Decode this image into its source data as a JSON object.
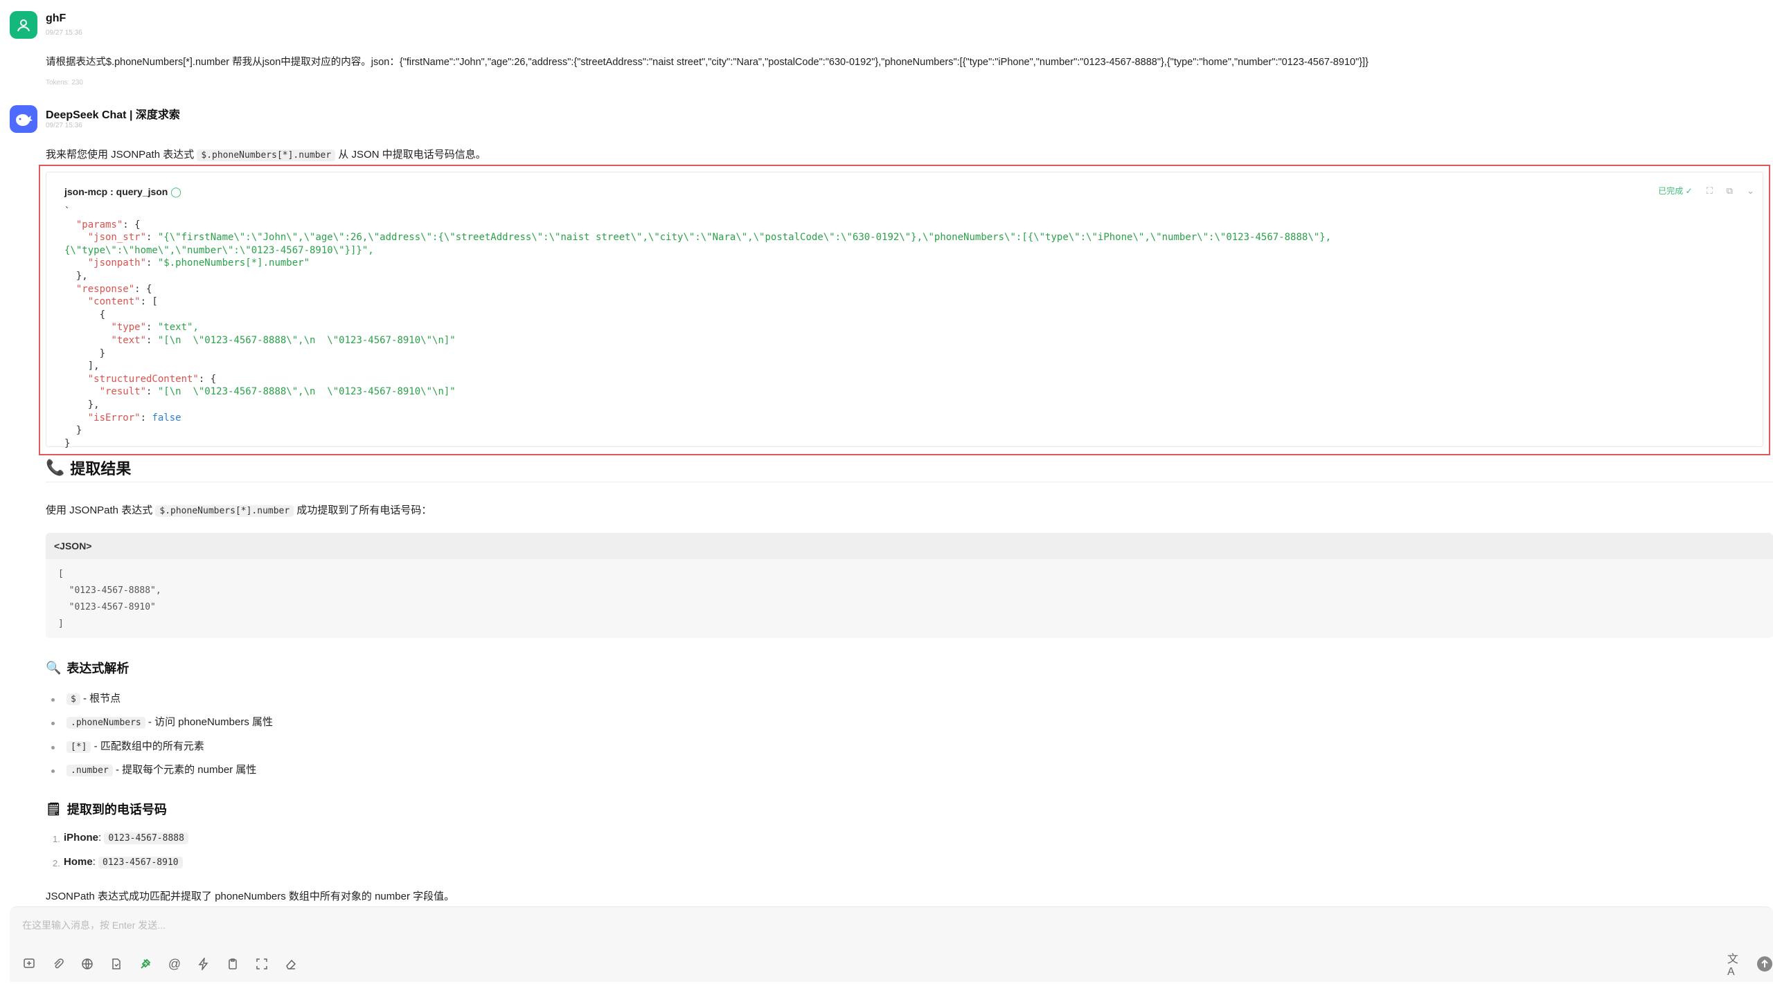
{
  "user_message": {
    "name": "ghF",
    "time": "09/27 15:36",
    "text": "请根据表达式$.phoneNumbers[*].number 帮我从json中提取对应的内容。json：{\"firstName\":\"John\",\"age\":26,\"address\":{\"streetAddress\":\"naist street\",\"city\":\"Nara\",\"postalCode\":\"630-0192\"},\"phoneNumbers\":[{\"type\":\"iPhone\",\"number\":\"0123-4567-8888\"},{\"type\":\"home\",\"number\":\"0123-4567-8910\"}]}",
    "tokens": "Tokens: 230"
  },
  "bot_message": {
    "name": "DeepSeek Chat | 深度求索",
    "time": "09/27 15:36",
    "intro_before": "我来帮您使用 JSONPath 表达式",
    "intro_code": "$.phoneNumbers[*].number",
    "intro_after": "从 JSON 中提取电话号码信息。"
  },
  "tool_call": {
    "title": "json-mcp : query_json",
    "status": "已完成",
    "params_key": "\"params\"",
    "json_str_key": "\"json_str\"",
    "json_str_value_1": "\"{\\\"firstName\\\":\\\"John\\\",\\\"age\\\":26,\\\"address\\\":{\\\"streetAddress\\\":\\\"naist street\\\",\\\"city\\\":\\\"Nara\\\",\\\"postalCode\\\":\\\"630-0192\\\"},\\\"phoneNumbers\\\":[{\\\"type\\\":\\\"iPhone\\\",\\\"number\\\":\\\"0123-4567-8888\\\"},",
    "json_str_value_2": "{\\\"type\\\":\\\"home\\\",\\\"number\\\":\\\"0123-4567-8910\\\"}]}\",",
    "jsonpath_key": "\"jsonpath\"",
    "jsonpath_value": "\"$.phoneNumbers[*].number\"",
    "response_key": "\"response\"",
    "content_key": "\"content\"",
    "type_key": "\"type\"",
    "type_value": "\"text\",",
    "text_key": "\"text\"",
    "text_value": "\"[\\n  \\\"0123-4567-8888\\\",\\n  \\\"0123-4567-8910\\\"\\n]\"",
    "structured_key": "\"structuredContent\"",
    "result_key": "\"result\"",
    "result_value": "\"[\\n  \\\"0123-4567-8888\\\",\\n  \\\"0123-4567-8910\\\"\\n]\"",
    "iserror_key": "\"isError\"",
    "iserror_value": "false"
  },
  "result_section": {
    "heading": "提取结果",
    "desc_before": "使用 JSONPath 表达式",
    "desc_code": "$.phoneNumbers[*].number",
    "desc_after": "成功提取到了所有电话号码：",
    "code_lang": "<JSON>",
    "code_body": "[\n  \"0123-4567-8888\",\n  \"0123-4567-8910\"\n]"
  },
  "analysis_section": {
    "heading": "表达式解析",
    "items": [
      {
        "code": "$",
        "text": "- 根节点"
      },
      {
        "code": ".phoneNumbers",
        "text": "- 访问 phoneNumbers 属性"
      },
      {
        "code": "[*]",
        "text": "- 匹配数组中的所有元素"
      },
      {
        "code": ".number",
        "text": "- 提取每个元素的 number 属性"
      }
    ]
  },
  "numbers_section": {
    "heading": "提取到的电话号码",
    "items": [
      {
        "num": "1.",
        "label": "iPhone",
        "value": "0123-4567-8888"
      },
      {
        "num": "2.",
        "label": "Home",
        "value": "0123-4567-8910"
      }
    ],
    "summary": "JSONPath 表达式成功匹配并提取了 phoneNumbers 数组中所有对象的 number 字段值。"
  },
  "input": {
    "placeholder": "在这里输入消息，按 Enter 发送..."
  }
}
